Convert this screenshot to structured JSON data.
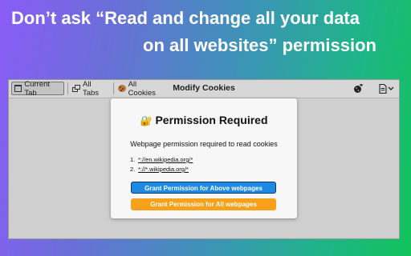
{
  "headline": {
    "line1": "Don’t ask “Read and change all your data",
    "line2": "on all websites” permission"
  },
  "toolbar": {
    "tabs": [
      {
        "label": "Current Tab",
        "icon": "window-icon"
      },
      {
        "label": "All Tabs",
        "icon": "tabs-icon"
      },
      {
        "label": "All Cookies",
        "icon": "cookie-icon"
      }
    ],
    "title": "Modify Cookies",
    "right_icons": [
      "add-cookie-icon",
      "export-dropdown-icon"
    ]
  },
  "modal": {
    "title": "Permission Required",
    "lock_icon": "🔐",
    "message": "Webpage permission required to read cookies",
    "urls": [
      {
        "num": "1.",
        "url": "*://en.wikipedia.org/*"
      },
      {
        "num": "2.",
        "url": "*://*.wikipedia.org/*"
      }
    ],
    "btn_above": "Grant Permission for Above webpages",
    "btn_all": "Grant Permission for All webpages"
  },
  "colors": {
    "blue_button": "#1e88e5",
    "orange_button": "#f7a01a",
    "gradient_start": "#8a5cf6",
    "gradient_end": "#11c35a"
  }
}
